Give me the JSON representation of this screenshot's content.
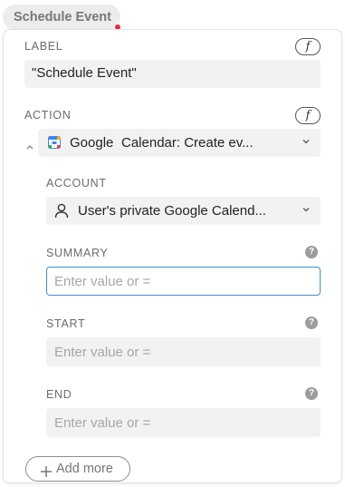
{
  "header": {
    "chip_label": "Schedule Event"
  },
  "label_section": {
    "heading": "LABEL",
    "fx_symbol": "f",
    "value": "\"Schedule Event\""
  },
  "action_section": {
    "heading": "ACTION",
    "fx_symbol": "f",
    "app_icon": "google-calendar-icon",
    "app_name": "Google",
    "action_name": "Calendar: Create ev..."
  },
  "account_section": {
    "heading": "ACCOUNT",
    "icon": "user-icon",
    "value": "User's private Google Calend..."
  },
  "fields": [
    {
      "heading": "SUMMARY",
      "placeholder": "Enter value or =",
      "focused": true
    },
    {
      "heading": "START",
      "placeholder": "Enter value or =",
      "focused": false
    },
    {
      "heading": "END",
      "placeholder": "Enter value or =",
      "focused": false
    }
  ],
  "help_symbol": "?",
  "add_more_label": "Add more",
  "colors": {
    "focus_border": "#3d8fd1",
    "field_bg": "#f2f2f2",
    "badge_red": "#e0303a"
  }
}
